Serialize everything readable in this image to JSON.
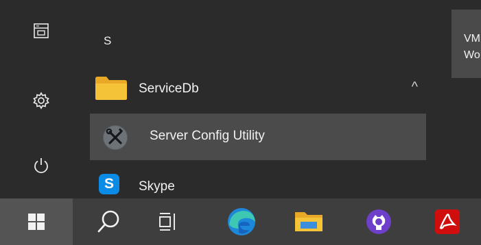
{
  "rail": {
    "items": [
      {
        "name": "documents-icon"
      },
      {
        "name": "settings-icon"
      },
      {
        "name": "power-icon"
      }
    ]
  },
  "app_list": {
    "section_letter": "S",
    "folder": {
      "label": "ServiceDb",
      "expand_glyph": "^"
    },
    "selected_app": {
      "label": "Server Config Utility"
    },
    "next_app": {
      "label": "Skype",
      "glyph": "S"
    }
  },
  "tile": {
    "line1": "VM",
    "line2": "Wo"
  },
  "taskbar": {
    "items": [
      "windows-start-icon",
      "search-icon",
      "task-view-icon",
      "edge-icon",
      "file-explorer-icon",
      "github-desktop-icon",
      "acrobat-icon"
    ]
  },
  "colors": {
    "accent_folder": "#f5c338",
    "skype": "#0a8be6",
    "edge": "#1e88d8",
    "github": "#6e40c9",
    "acrobat": "#d10e0e"
  }
}
